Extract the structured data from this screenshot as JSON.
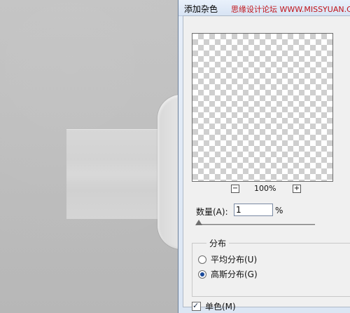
{
  "dialog": {
    "title": "添加杂色",
    "watermark": "思缘设计论坛 WWW.MISSYUAN.COM"
  },
  "preview": {
    "zoom_level": "100%",
    "zoom_minus": "−",
    "zoom_plus": "+"
  },
  "amount": {
    "label": "数量(A):",
    "value": "1",
    "unit": "%",
    "slider_fraction": 0.01
  },
  "distribution": {
    "title": "分布",
    "options": [
      {
        "label": "平均分布(U)",
        "selected": false
      },
      {
        "label": "高斯分布(G)",
        "selected": true
      }
    ]
  },
  "monochromatic": {
    "label": "单色(M)",
    "checked": true
  },
  "colors": {
    "accent": "#3a78c3",
    "watermark": "#c1141a"
  }
}
